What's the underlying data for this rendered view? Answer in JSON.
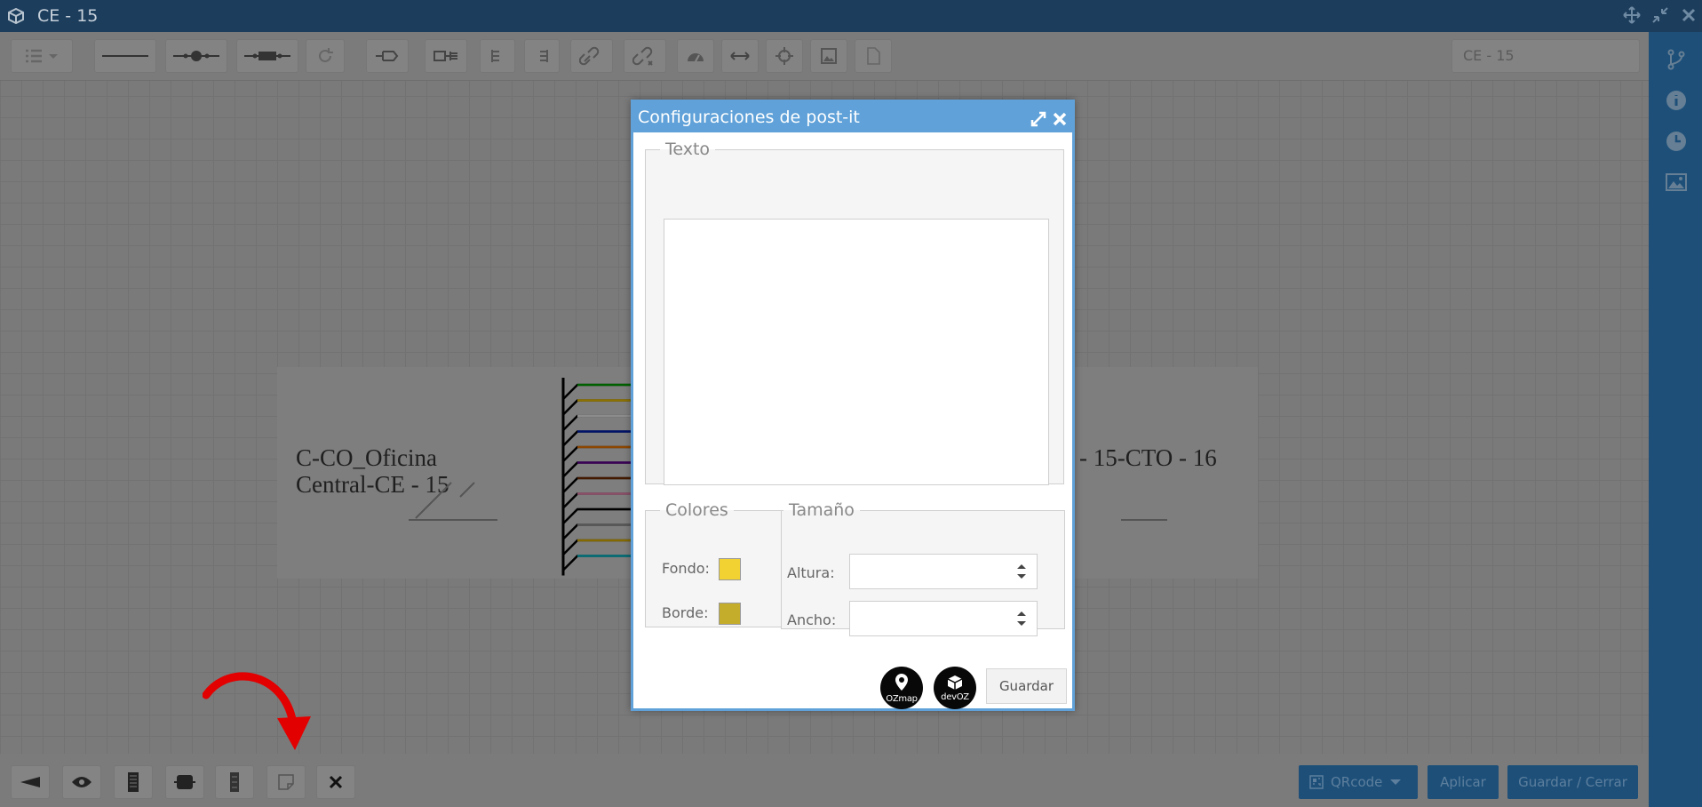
{
  "window": {
    "title": "CE - 15"
  },
  "toolbar": {
    "doc_name": "CE - 15",
    "icons": [
      "list-icon",
      "line-icon",
      "splice-icon",
      "connector-icon",
      "refresh-icon",
      "splitter-left-icon",
      "splitter-right-icon",
      "tree-left-icon",
      "tree-right-icon",
      "link-icon",
      "unlink-icon",
      "dashboard-icon",
      "resize-icon",
      "center-icon",
      "image-icon",
      "pdf-icon"
    ]
  },
  "canvas": {
    "left_label_line1": "C-CO_Oficina",
    "left_label_line2": "Central-CE - 15",
    "right_label": "- 15-CTO - 16",
    "fiber_colors": [
      "#00b000",
      "#ffd000",
      "#ffffff",
      "#0020c0",
      "#ff8000",
      "#6a00a0",
      "#7a2e00",
      "#ff90c0",
      "#000000",
      "#a0a0a0",
      "#f0c000",
      "#00c8d8"
    ]
  },
  "dialog": {
    "title": "Configuraciones de post-it",
    "texto_legend": "Texto",
    "texto_value": "",
    "colores_legend": "Colores",
    "fondo_label": "Fondo:",
    "fondo_color": "#f1d232",
    "borde_label": "Borde:",
    "borde_color": "#c4ad2b",
    "tamano_legend": "Tamaño",
    "altura_label": "Altura:",
    "altura_value": "",
    "ancho_label": "Ancho:",
    "ancho_value": "",
    "logo1_text": "OZmap",
    "logo2_text": "devOZ",
    "save_label": "Guardar"
  },
  "bottombar": {
    "qrcode_label": "QRcode",
    "apply_label": "Aplicar",
    "save_close_label": "Guardar / Cerrar"
  },
  "annotation": {
    "arrow_color": "#e30000"
  },
  "right_panel": {
    "icons": [
      "branch-icon",
      "info-icon",
      "clock-icon",
      "image-icon"
    ]
  }
}
